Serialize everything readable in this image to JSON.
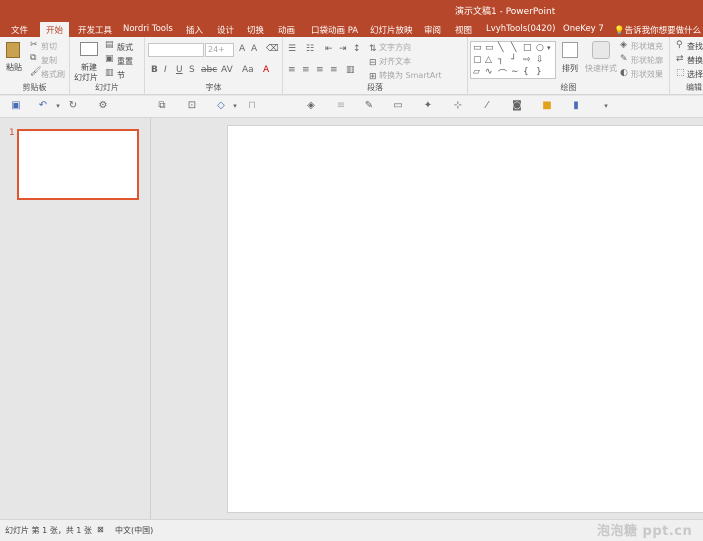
{
  "window": {
    "title": "演示文稿1 - PowerPoint"
  },
  "tabs": [
    "文件",
    "开始",
    "开发工具",
    "Nordri Tools",
    "插入",
    "设计",
    "切换",
    "动画",
    "口袋动画 PA",
    "幻灯片放映",
    "审阅",
    "视图",
    "LvyhTools(0420)",
    "OneKey 7"
  ],
  "tell_me": "告诉我你想要做什么",
  "clipboard": {
    "paste": "粘贴",
    "cut": "剪切",
    "copy": "复制",
    "format_painter": "格式刷",
    "label": "剪贴板"
  },
  "slides": {
    "new_slide_1": "新建",
    "new_slide_2": "幻灯片",
    "layout": "版式",
    "reset": "重置",
    "section": "节",
    "label": "幻灯片"
  },
  "font": {
    "size": "24+",
    "label": "字体"
  },
  "paragraph": {
    "text_direction": "文字方向",
    "align_text": "对齐文本",
    "smartart": "转换为 SmartArt",
    "label": "段落"
  },
  "drawing": {
    "arrange": "排列",
    "quick_styles": "快速样式",
    "fill": "形状填充",
    "outline": "形状轮廓",
    "effects": "形状效果",
    "label": "绘图"
  },
  "editing": {
    "find": "查找",
    "replace": "替换",
    "select": "选择",
    "label": "编辑"
  },
  "thumbnails": {
    "slide_number": "1"
  },
  "status": {
    "slide_info": "幻灯片 第 1 张，共 1 张",
    "language": "中文(中国)"
  },
  "watermark": "泡泡糖 ppt.cn",
  "colors": {
    "accent": "#b7472a",
    "selection": "#e0572f"
  },
  "icons": {
    "tell_me": "lightbulb-icon"
  }
}
